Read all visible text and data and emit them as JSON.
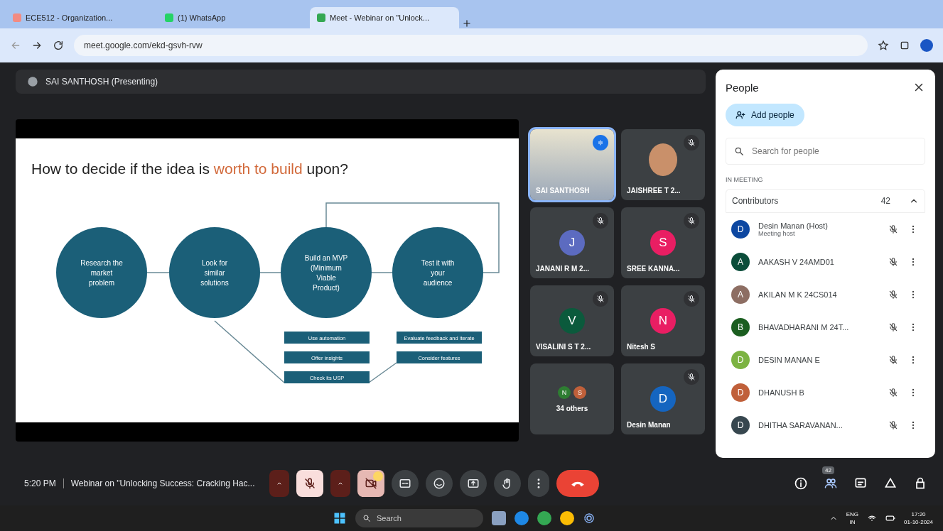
{
  "browser": {
    "tabs": [
      {
        "title": "ECE512 - Organization...",
        "selected": false
      },
      {
        "title": "(1) WhatsApp",
        "selected": false
      },
      {
        "title": "Meet - Webinar on \"Unlock...",
        "selected": true
      }
    ],
    "address": "meet.google.com/ekd-gsvh-rvw"
  },
  "presenter_bar": {
    "label": "SAI SANTHOSH (Presenting)"
  },
  "slide": {
    "title": [
      {
        "kind": "plain",
        "text": "How to decide if the idea is "
      },
      {
        "kind": "highlight",
        "text": "worth to build"
      },
      {
        "kind": "plain",
        "text": " upon?"
      }
    ],
    "steps": [
      {
        "lines": [
          "Research the",
          "market",
          "problem"
        ]
      },
      {
        "lines": [
          "Look for",
          "similar",
          "solutions"
        ]
      },
      {
        "lines": [
          "Build an MVP",
          "(Minimum",
          "Viable",
          "Product)"
        ]
      },
      {
        "lines": [
          "Test it with",
          "your",
          "audience"
        ]
      }
    ],
    "box_groups": [
      {
        "boxes": [
          "Use automation",
          "Offer insights",
          "Check its USP"
        ]
      },
      {
        "boxes": [
          "Evaluate feedback and iterate",
          "Consider features"
        ]
      }
    ]
  },
  "tiles": [
    {
      "kind": "video",
      "name": "SAI SANTHOSH",
      "speaking": true
    },
    {
      "kind": "photo",
      "name": "JAISHREE T 2...",
      "speaking": false
    },
    {
      "kind": "avatar",
      "name": "JANANI R M 2...",
      "initial": "J",
      "color": "#5c6bc0",
      "speaking": false
    },
    {
      "kind": "avatar",
      "name": "SREE KANNA...",
      "initial": "S",
      "color": "#e91e63",
      "speaking": false
    },
    {
      "kind": "avatar",
      "name": "VISALINI S T 2...",
      "initial": "V",
      "color": "#0b5a3c",
      "speaking": false
    },
    {
      "kind": "avatar",
      "name": "Nitesh S",
      "initial": "N",
      "color": "#e91e63",
      "speaking": false
    },
    {
      "kind": "others",
      "name": "34 others",
      "initials": [
        {
          "initial": "N",
          "color": "#2e7d32"
        },
        {
          "initial": "S",
          "color": "#c0603a"
        }
      ]
    },
    {
      "kind": "avatar",
      "name": "Desin Manan",
      "initial": "D",
      "color": "#1565c0",
      "speaking": false
    }
  ],
  "people_panel": {
    "title": "People",
    "add_button": "Add people",
    "search_placeholder": "Search for people",
    "section": "IN MEETING",
    "group": {
      "label": "Contributors",
      "count": "42",
      "expanded": true
    },
    "people": [
      {
        "name": "Desin Manan (Host)",
        "subtitle": "Meeting host",
        "initial": "D",
        "color": "#0d47a1"
      },
      {
        "name": "AAKASH V 24AMD01",
        "initial": "A",
        "color": "#0b4d3a"
      },
      {
        "name": "AKILAN M K 24CS014",
        "initial": "A",
        "color": "#8d6e63"
      },
      {
        "name": "BHAVADHARANI M 24T...",
        "initial": "B",
        "color": "#1b5e20"
      },
      {
        "name": "DESIN MANAN E",
        "initial": "D",
        "color": "#7cb342"
      },
      {
        "name": "DHANUSH B",
        "initial": "D",
        "color": "#c0603a"
      },
      {
        "name": "DHITHA SARAVANAN...",
        "initial": "D",
        "color": "#37474f"
      }
    ]
  },
  "meeting_bar": {
    "time": "5:20 PM",
    "title": "Webinar on \"Unlocking Success: Cracking Hac...",
    "people_badge": "42"
  },
  "taskbar": {
    "search": "Search",
    "lang": "ENG",
    "region": "IN",
    "time": "17:20",
    "date": "01-10-2024"
  }
}
